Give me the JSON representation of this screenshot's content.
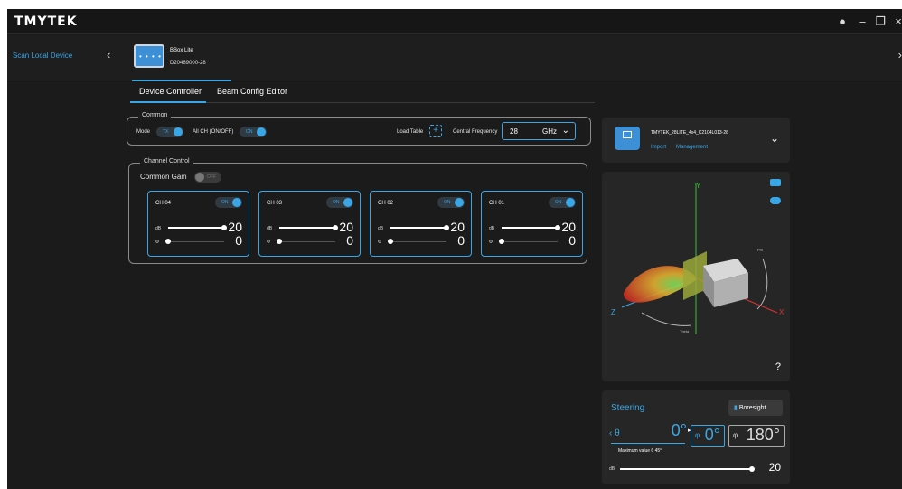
{
  "app": {
    "logo": "TMYTEK"
  },
  "window_controls": {
    "info": "●",
    "minimize": "–",
    "restore": "❐",
    "close": "×"
  },
  "device_bar": {
    "scan_label": "Scan Local Device",
    "prev": "‹",
    "next": "›",
    "device": {
      "name": "BBox Lite",
      "serial": "D20469000-28"
    }
  },
  "tabs": [
    {
      "label": "Device Controller",
      "active": true
    },
    {
      "label": "Beam Config Editor",
      "active": false
    }
  ],
  "common": {
    "legend": "Common",
    "mode_label": "Mode",
    "mode_value": "TX",
    "allch_label": "All CH (ON/OFF)",
    "allch_value": "ON",
    "load_table_label": "Load Table",
    "central_freq_label": "Central Frequency",
    "central_freq_value": "28",
    "central_freq_unit": "GHz"
  },
  "channel_control": {
    "legend": "Channel Control",
    "common_gain_label": "Common Gain",
    "common_gain_value": "OFF",
    "channels": [
      {
        "title": "CH 04",
        "toggle": "ON",
        "db_label": "dB",
        "db": "20",
        "db_level": 1.0,
        "phase_label": "Φ",
        "phase": "0",
        "phase_level": 0.0
      },
      {
        "title": "CH 03",
        "toggle": "ON",
        "db_label": "dB",
        "db": "20",
        "db_level": 1.0,
        "phase_label": "Φ",
        "phase": "0",
        "phase_level": 0.0
      },
      {
        "title": "CH 02",
        "toggle": "ON",
        "db_label": "dB",
        "db": "20",
        "db_level": 1.0,
        "phase_label": "Φ",
        "phase": "0",
        "phase_level": 0.0
      },
      {
        "title": "CH 01",
        "toggle": "ON",
        "db_label": "dB",
        "db": "20",
        "db_level": 1.0,
        "phase_label": "Φ",
        "phase": "0",
        "phase_level": 0.0
      }
    ]
  },
  "profile": {
    "name": "TMYTEK_28LITE_4x4_C2104L013-28",
    "import_label": "Import",
    "management_label": "Management",
    "chevron": "⌄"
  },
  "viewer": {
    "axis_x": "X",
    "axis_y": "Y",
    "axis_z": "Z",
    "phi_label": "Phi",
    "theta_label": "Theta",
    "help": "?"
  },
  "steering": {
    "title": "Steering",
    "boresight_label": "Boresight",
    "theta_symbol": "θ",
    "theta_value": "0°",
    "phi_symbol": "φ",
    "phi_value_a": "0°",
    "phi_value_b": "180°",
    "max_value_text": "Maximum value θ 45°",
    "db_label": "dB",
    "db_value": "20",
    "db_level": 1.0
  },
  "colors": {
    "accent": "#3aa6e6",
    "panel": "#262626",
    "background": "#1b1b1b"
  }
}
